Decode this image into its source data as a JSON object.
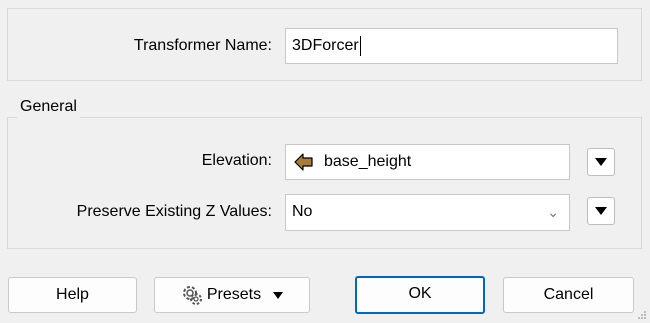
{
  "name_section": {
    "label": "Transformer Name:",
    "value": "3DForcer"
  },
  "general": {
    "title": "General",
    "elevation_label": "Elevation:",
    "elevation_value": "base_height",
    "elevation_icon": "attribute-arrow-icon",
    "preserve_label": "Preserve Existing Z Values:",
    "preserve_value": "No"
  },
  "buttons": {
    "help": "Help",
    "presets": "Presets",
    "ok": "OK",
    "cancel": "Cancel"
  },
  "colors": {
    "attribute_icon_fill": "#a77d3c",
    "ok_border": "#0067c0"
  }
}
